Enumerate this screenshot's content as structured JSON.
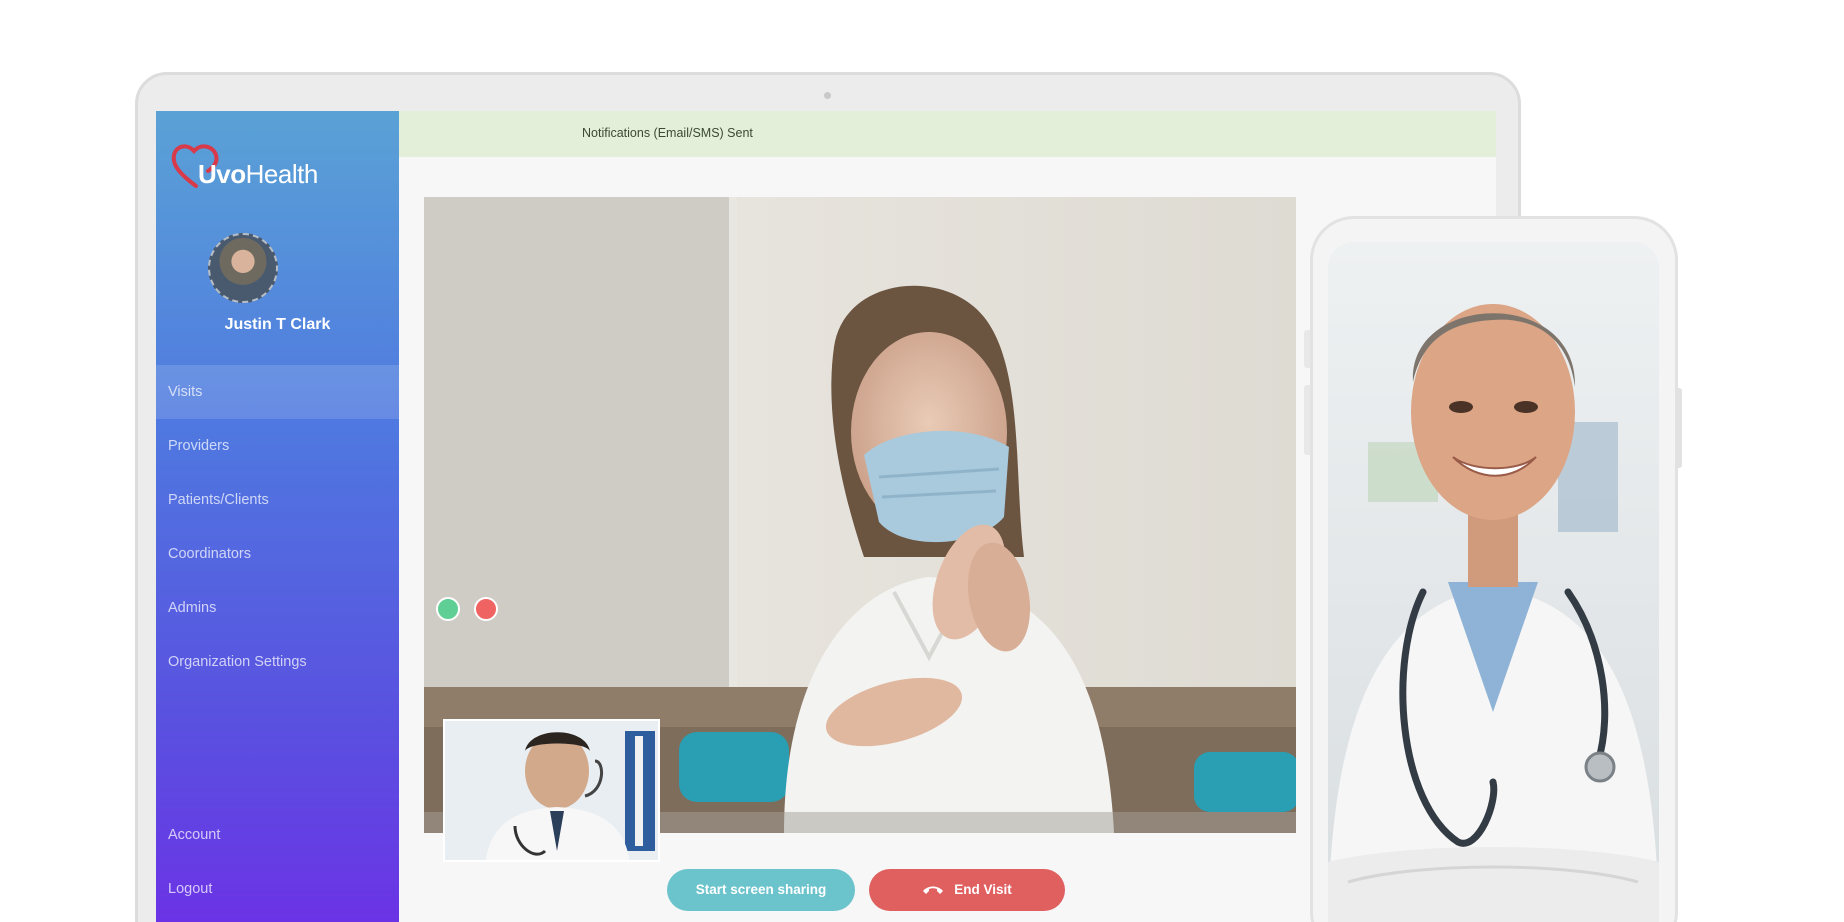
{
  "app": {
    "brand": "Uvo Health",
    "brand_bold": "Uvo",
    "brand_light": "Health",
    "user_name": "Justin T Clark"
  },
  "sidebar": {
    "items": [
      {
        "label": "Visits",
        "active": true
      },
      {
        "label": "Providers"
      },
      {
        "label": "Patients/Clients"
      },
      {
        "label": "Coordinators"
      },
      {
        "label": "Admins"
      },
      {
        "label": "Organization Settings"
      }
    ],
    "bottom_items": [
      {
        "label": "Account"
      },
      {
        "label": "Logout"
      }
    ]
  },
  "notification": {
    "text": "Notifications (Email/SMS) Sent"
  },
  "controls": {
    "share_label": "Start screen sharing",
    "end_label": "End Visit"
  },
  "colors": {
    "accent_share": "#6bc3cc",
    "accent_end": "#e06060",
    "notif_bg": "#e3efd9",
    "sidebar_top": "#5aa2d6",
    "sidebar_bottom": "#6d30e6"
  },
  "icons": {
    "logo": "heart-logo-icon",
    "end_call": "phone-hangup-icon",
    "self_view_on": "green-status-dot",
    "self_view_close": "red-close-dot"
  }
}
